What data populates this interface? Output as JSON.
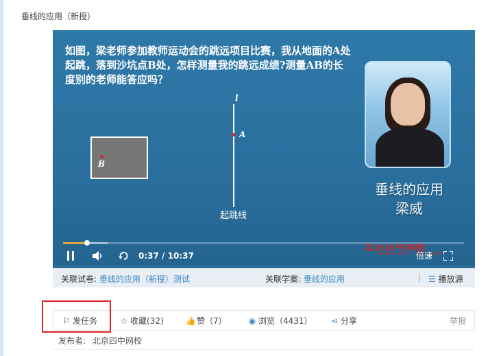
{
  "page": {
    "title": "垂线的应用（新授）"
  },
  "video": {
    "question": "如图，梁老师参加教师运动会的跳远项目比赛，我从地面的A处起跳，落到沙坑点B处，怎样测量我的跳远成绩?测量AB的长度别的老师能答应吗？",
    "label_l": "l",
    "label_a": "A",
    "label_b": "B",
    "start_line": "起跳线",
    "caption_title": "垂线的应用",
    "caption_name": "梁威",
    "watermark": "北京四中网校",
    "watermark_url": "www.eti...cn.com",
    "current_time": "0:37",
    "total_time": "10:37",
    "time_sep": "/",
    "progress": 0.059,
    "speed_label": "倍速",
    "icons": [
      "play-pause-icon",
      "volume-icon",
      "loop-icon",
      "fullscreen-icon"
    ]
  },
  "info_bar": {
    "paper_label": "关联试卷:",
    "paper_link": "垂线的应用（新授）测试",
    "plan_label": "关联学案:",
    "plan_link": "垂线的应用",
    "source_label": "播放源"
  },
  "actions": {
    "task": "发任务",
    "collect": "收藏(32)",
    "like": "赞（7）",
    "views": "浏览（4431）",
    "share": "分享",
    "report": "举报"
  },
  "publisher": {
    "label": "发布者:",
    "name": "北京四中网校"
  },
  "colors": {
    "link": "#3a88c9",
    "highlight": "#e02020",
    "player_bg": "#2b6c98",
    "progress_fill": "#e0a43c"
  }
}
